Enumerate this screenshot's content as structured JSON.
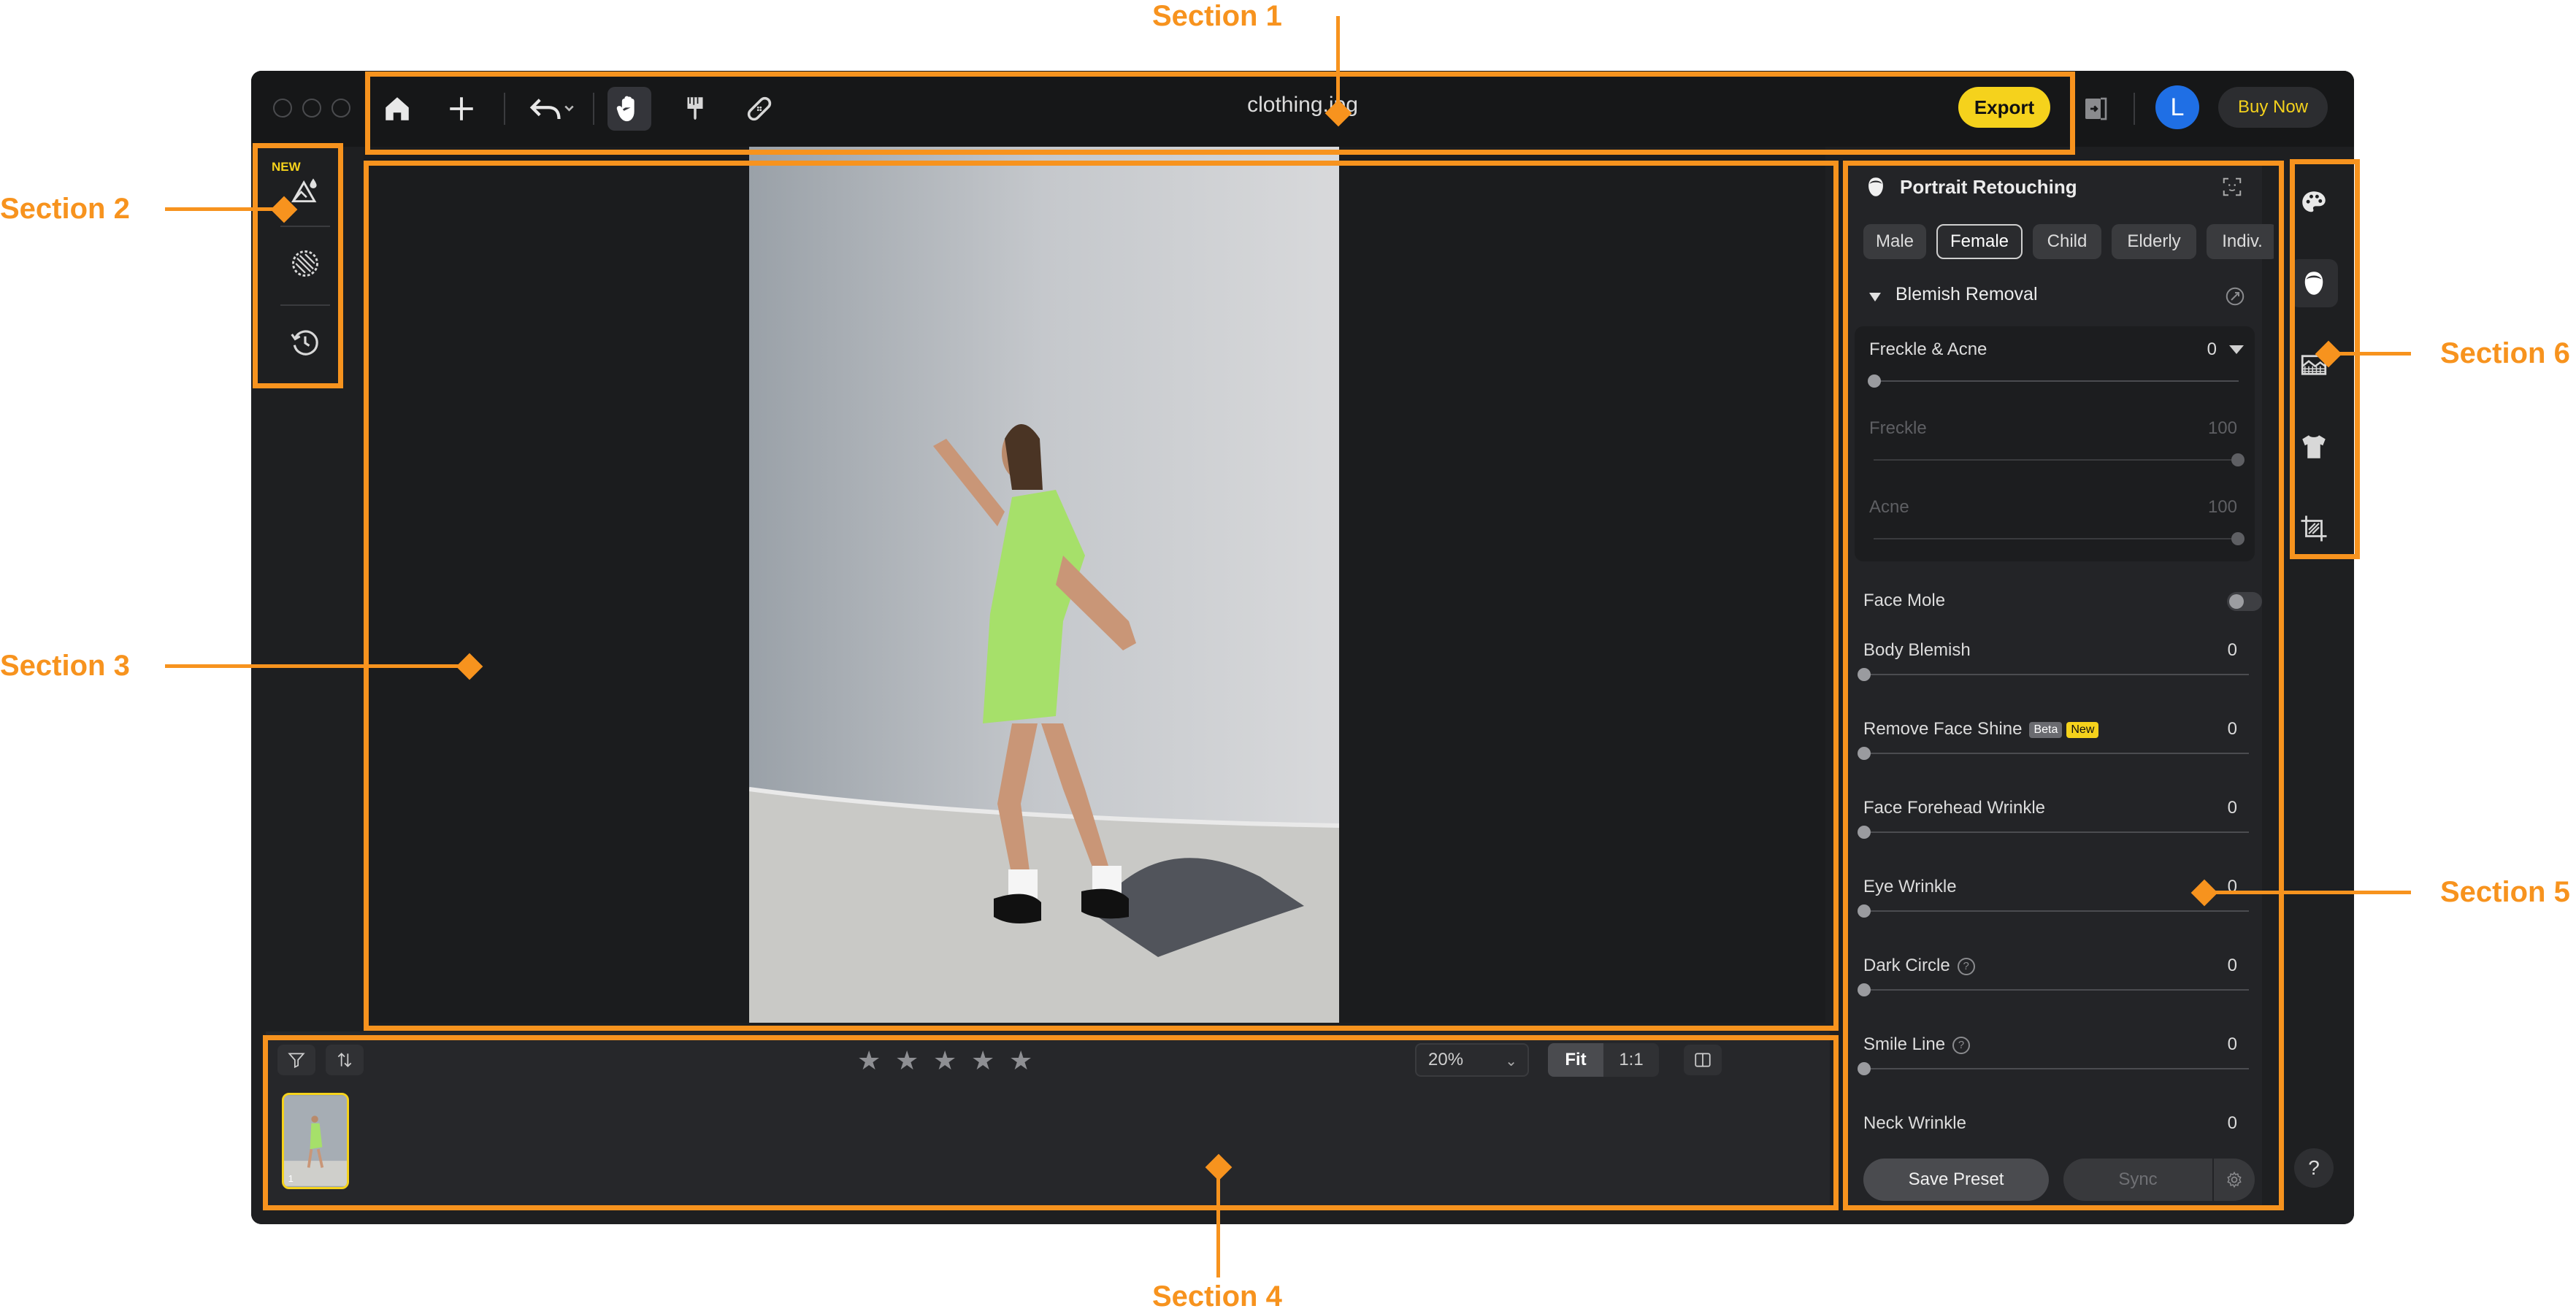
{
  "annotations": {
    "section1": "Section 1",
    "section2": "Section 2",
    "section3": "Section 3",
    "section4": "Section 4",
    "section5": "Section 5",
    "section6": "Section 6"
  },
  "titlebar": {
    "title": "clothing.jpg",
    "export_label": "Export",
    "avatar_initial": "L",
    "buy_label": "Buy Now",
    "icons": [
      "home-icon",
      "plus-icon",
      "undo-icon",
      "hand-icon",
      "brush-icon",
      "bandage-icon",
      "compare-icon"
    ]
  },
  "left_tools": {
    "new_label": "NEW",
    "icons": [
      "ai-adjust-icon",
      "texture-icon",
      "history-icon"
    ]
  },
  "filmstrip": {
    "zoom": "20%",
    "fit_label": "Fit",
    "one_to_one_label": "1:1",
    "rating_stars": 5,
    "thumb_index": "1"
  },
  "panel": {
    "title": "Portrait Retouching",
    "tabs": [
      {
        "label": "Male"
      },
      {
        "label": "Female"
      },
      {
        "label": "Child"
      },
      {
        "label": "Elderly"
      },
      {
        "label": "Indiv."
      }
    ],
    "selected_tab": "Female",
    "section_title": "Blemish Removal",
    "freckle_acne": {
      "label": "Freckle & Acne",
      "value": "0"
    },
    "freckle": {
      "label": "Freckle",
      "value": "100"
    },
    "acne": {
      "label": "Acne",
      "value": "100"
    },
    "face_mole": {
      "label": "Face Mole",
      "enabled": false
    },
    "sliders": [
      {
        "label": "Body Blemish",
        "value": "0"
      },
      {
        "label": "Remove Face Shine",
        "value": "0",
        "badge_beta": "Beta",
        "badge_new": "New"
      },
      {
        "label": "Face Forehead Wrinkle",
        "value": "0"
      },
      {
        "label": "Eye Wrinkle",
        "value": "0"
      },
      {
        "label": "Dark Circle",
        "value": "0"
      },
      {
        "label": "Smile Line",
        "value": "0"
      },
      {
        "label": "Neck Wrinkle",
        "value": "0"
      }
    ],
    "save_preset_label": "Save Preset",
    "sync_label": "Sync"
  },
  "right_bar": {
    "icons": [
      "palette-icon",
      "face-icon",
      "background-icon",
      "clothing-icon",
      "crop-icon"
    ],
    "help_label": "?"
  },
  "colors": {
    "accent_yellow": "#f5d21c",
    "annotation_orange": "#f7931e",
    "window_bg": "#1e1f21",
    "avatar_blue": "#1f6fe5"
  }
}
